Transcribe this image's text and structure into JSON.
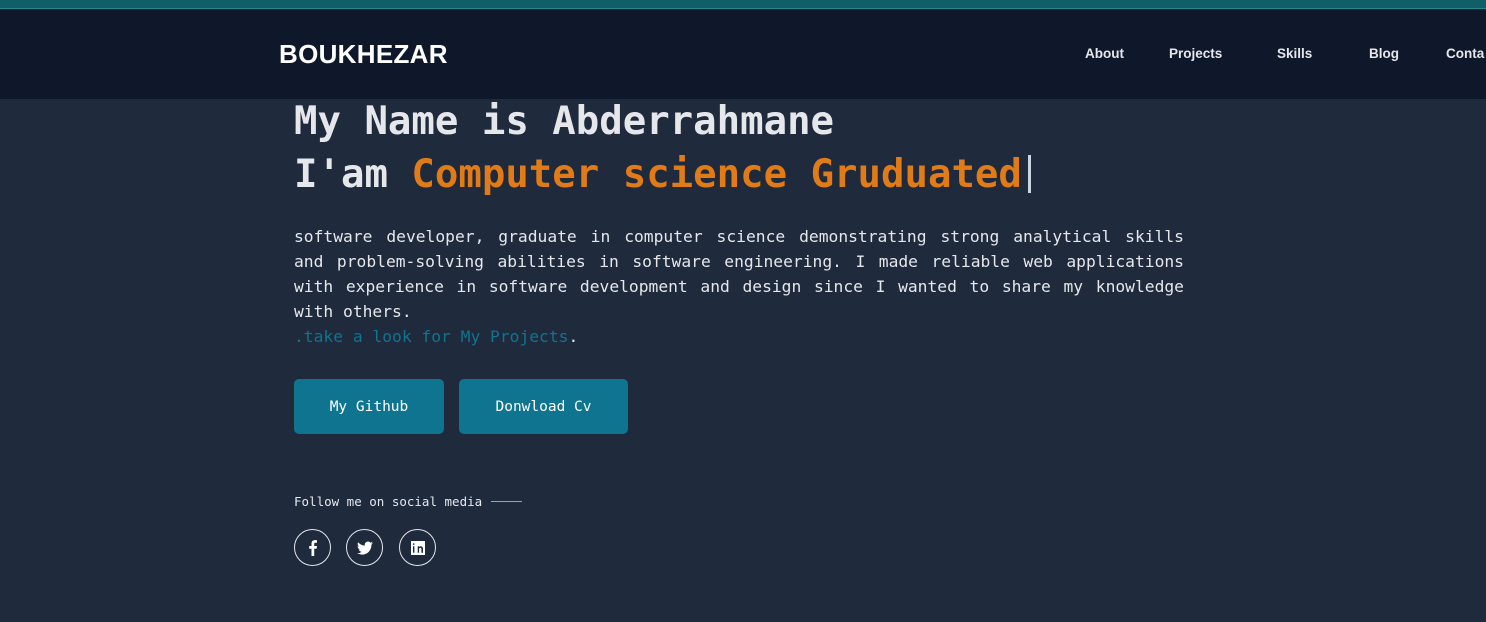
{
  "header": {
    "brand": "BOUKHEZAR",
    "nav": [
      "About",
      "Projects",
      "Skills",
      "Blog",
      "Conta"
    ]
  },
  "hero": {
    "headline_line1": "My Name is Abderrahmane",
    "headline_prefix": "I'am",
    "headline_typed": "Computer science Gruduated",
    "bio": "software developer, graduate in computer science demonstrating strong analytical skills and problem-solving abilities in software engineering. I made reliable web applications with experience in software development and design since I wanted to share my knowledge with others.",
    "projects_link": ".take a look for My Projects",
    "projects_suffix": ".",
    "buttons": {
      "github": "My Github",
      "cv": "Donwload Cv"
    }
  },
  "social": {
    "label": "Follow me on social media",
    "icons": [
      "facebook-icon",
      "twitter-icon",
      "linkedin-icon"
    ]
  },
  "colors": {
    "background": "#1f2a3d",
    "navbar": "#0f172a",
    "accent": "#e07b18",
    "button": "#0e7490",
    "link": "#0e7490"
  }
}
